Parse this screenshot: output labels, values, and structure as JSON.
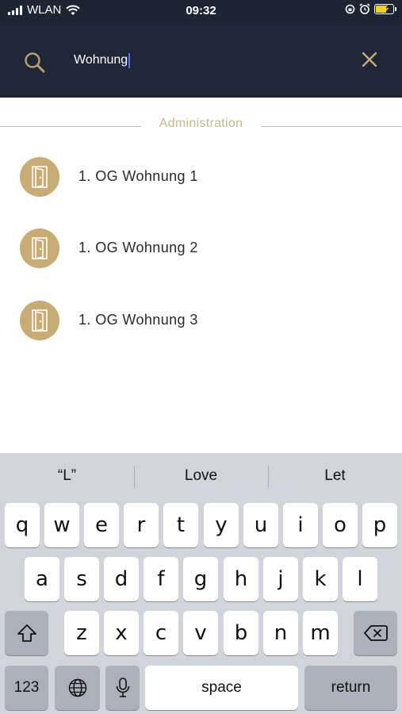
{
  "status_bar": {
    "carrier": "WLAN",
    "time": "09:32"
  },
  "search": {
    "value": "Wohnung",
    "icon": "search-icon",
    "clear_icon": "close-icon"
  },
  "section": {
    "title": "Administration"
  },
  "results": [
    {
      "icon": "door-icon",
      "label": "1.  OG Wohnung 1"
    },
    {
      "icon": "door-icon",
      "label": "1.  OG Wohnung 2"
    },
    {
      "icon": "door-icon",
      "label": "1.  OG Wohnung 3"
    }
  ],
  "keyboard": {
    "suggestions": [
      "“L”",
      "Love",
      "Let"
    ],
    "row1": [
      "q",
      "w",
      "e",
      "r",
      "t",
      "y",
      "u",
      "i",
      "o",
      "p"
    ],
    "row2": [
      "a",
      "s",
      "d",
      "f",
      "g",
      "h",
      "j",
      "k",
      "l"
    ],
    "row3": [
      "z",
      "x",
      "c",
      "v",
      "b",
      "n",
      "m"
    ],
    "numbers_label": "123",
    "space_label": "space",
    "return_label": "return"
  },
  "colors": {
    "header_bg": "#1f2638",
    "accent_gold": "#c9ac74",
    "battery_fill": "#f2d21b",
    "caret": "#3d7bff"
  }
}
